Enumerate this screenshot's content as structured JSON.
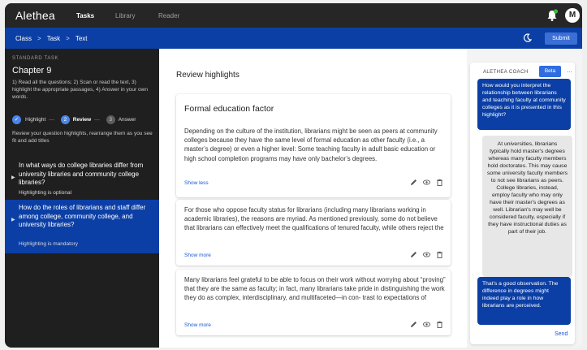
{
  "app": {
    "brand": "Alethea",
    "nav": [
      "Tasks",
      "Library",
      "Reader"
    ],
    "avatar_initial": "M",
    "accent_color": "#0b3fa5"
  },
  "breadcrumb": {
    "items": [
      "Class",
      "Task",
      "Text"
    ],
    "separator": ">",
    "submit_label": "Submit"
  },
  "sidebar": {
    "task_label": "STANDARD TASK",
    "chapter": "Chapter 9",
    "instructions": "1) Read all the questions; 2) Scan or read the text, 3) highlight the appropriate passages, 4) Answer in your own words.",
    "steps": [
      {
        "label": "Highlight",
        "num": "",
        "state": "done"
      },
      {
        "label": "Review",
        "num": "2",
        "state": "current"
      },
      {
        "label": "Answer",
        "num": "3",
        "state": "todo"
      }
    ],
    "step_hint": "Review your question highlights, rearrange them as you see fit and add titles",
    "questions": [
      {
        "text": "In what ways do college libraries differ from university libraries and community college libraries?",
        "status": "Highlighting is optional",
        "active": false
      },
      {
        "text": "How do the roles of librarians and staff differ among college, community college, and university libraries?",
        "status": "Highlighting is mandatory",
        "active": true
      }
    ]
  },
  "main": {
    "title": "Review highlights",
    "cards": [
      {
        "title": "Formal education factor",
        "text": "Depending on the culture of the institution, librarians might be seen as peers at community colleges because they have the same level of formal education as other faculty (i.e., a master’s degree) or even a higher level: Some teaching faculty in adult basic education or high school completion programs may have only bachelor’s degrees.",
        "link": "Show less"
      },
      {
        "title": "",
        "text": "For those who oppose faculty status for librarians (including many librarians working in academic libraries), the reasons are myriad. As mentioned previously, some do not believe that librarians can effectively meet the qualifications of tenured faculty, while others reject the",
        "link": "Show more"
      },
      {
        "title": "",
        "text": "Many librarians feel grateful to be able to focus on their work without worrying about “proving” that they are the same as faculty; in fact, many librarians take pride in distinguishing the work they do as complex, interdisciplinary, and multifaceted—in con- trast to expectations of",
        "link": "Show more"
      }
    ]
  },
  "coach": {
    "title": "ALETHEA COACH",
    "badge": "Beta",
    "menu": "...",
    "messages": [
      {
        "from": "coach",
        "text": "How would you interpret the relationship between librarians and teaching faculty at community colleges as it is presented in this highlight?"
      },
      {
        "from": "user",
        "text": "At universities, librarians typically hold master's degrees whereas many faculty members hold doctorates. This may cause some university faculty members to not see librarians as peers. College libraries, instead, employ faculty who may only have their master's degrees as well. Librarian's may well be considered faculty, especially if they have instructional duties as part of their job."
      },
      {
        "from": "coach",
        "text": "That's a good observation. The difference in degrees might indeed play a role in how librarians are perceived."
      }
    ],
    "send_label": "Send"
  }
}
